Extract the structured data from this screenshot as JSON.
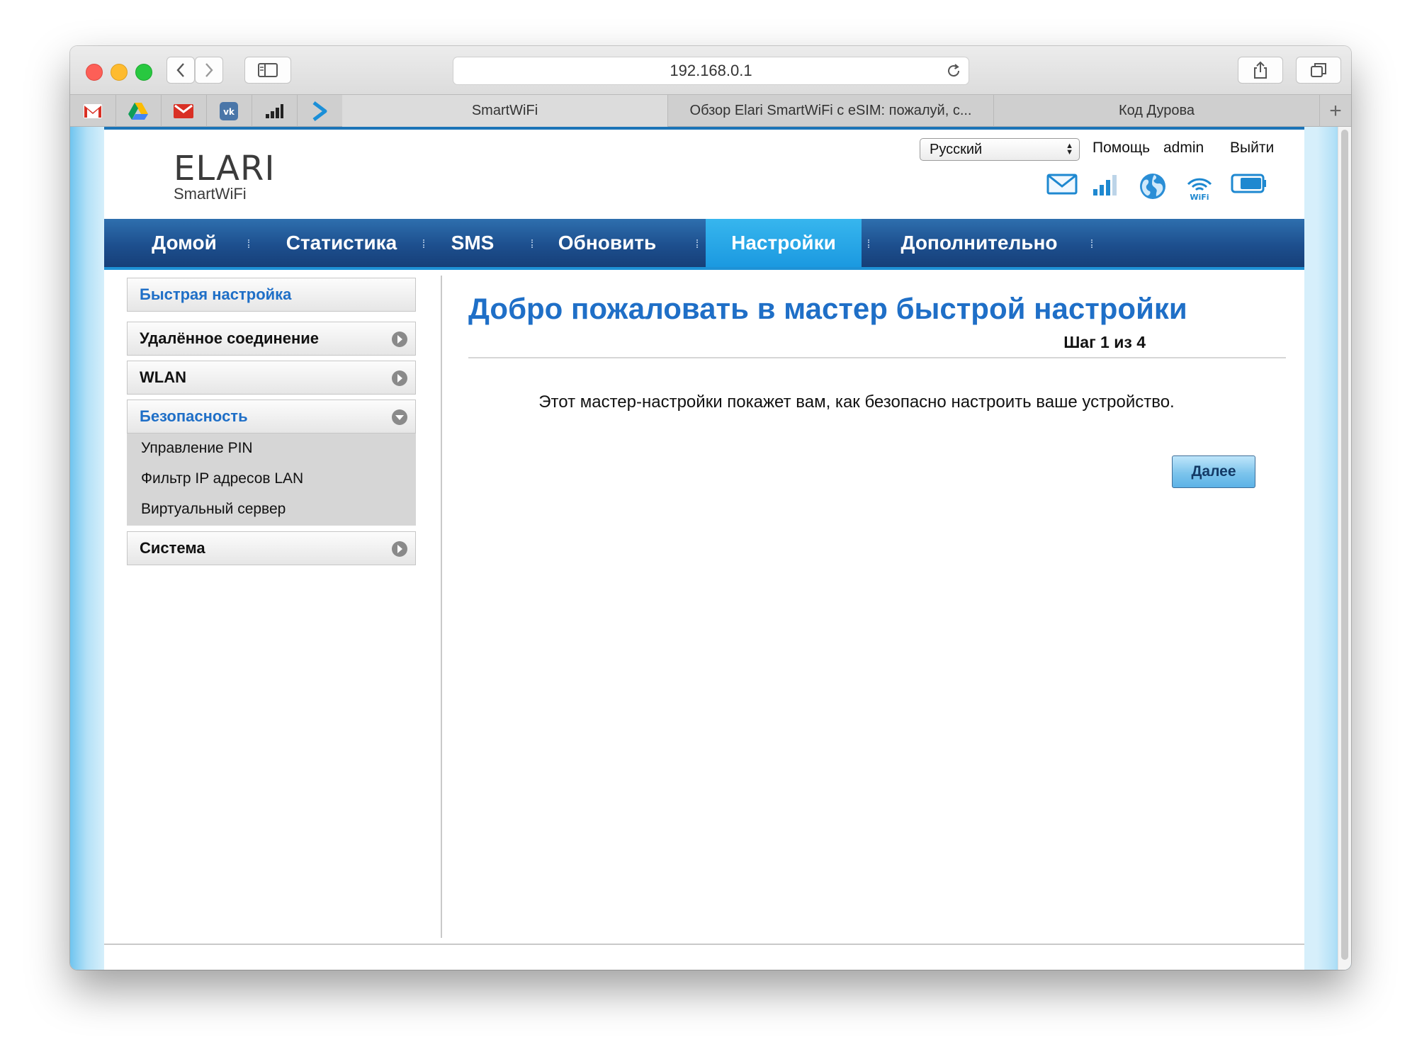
{
  "browser": {
    "url": "192.168.0.1",
    "tabs": [
      {
        "title": "SmartWiFi",
        "active": true
      },
      {
        "title": "Обзор Elari SmartWiFi с eSIM: пожалуй, с...",
        "active": false
      },
      {
        "title": "Код Дурова",
        "active": false
      }
    ],
    "favorites": [
      "gmail-icon",
      "drive-icon",
      "gmail-red-icon",
      "vk-icon",
      "signal-bars-icon",
      "arrow-logo-icon"
    ]
  },
  "header": {
    "logo_main": "ELARI",
    "logo_sub": "SmartWiFi",
    "language": "Русский",
    "help": "Помощь",
    "user": "admin",
    "logout": "Выйти"
  },
  "status_icons": [
    "mail-icon",
    "signal-icon",
    "globe-icon",
    "wifi-icon",
    "battery-icon"
  ],
  "nav": {
    "items": [
      "Домой",
      "Статистика",
      "SMS",
      "Обновить",
      "Настройки",
      "Дополнительно"
    ],
    "active": "Настройки"
  },
  "sidebar": {
    "quick_setup": "Быстрая настройка",
    "remote": "Удалённое соединение",
    "wlan": "WLAN",
    "security": "Безопасность",
    "security_items": [
      "Управление PIN",
      "Фильтр IP адресов LAN",
      "Виртуальный сервер"
    ],
    "system": "Система"
  },
  "main": {
    "title": "Добро пожаловать в мастер быстрой настройки",
    "step": "Шаг 1 из 4",
    "description": "Этот мастер-настройки покажет вам, как безопасно настроить ваше устройство.",
    "next_button": "Далее"
  },
  "colors": {
    "accent": "#1f6fc7",
    "nav_bg": "#1d4f8e",
    "nav_active": "#2aa8e8"
  }
}
